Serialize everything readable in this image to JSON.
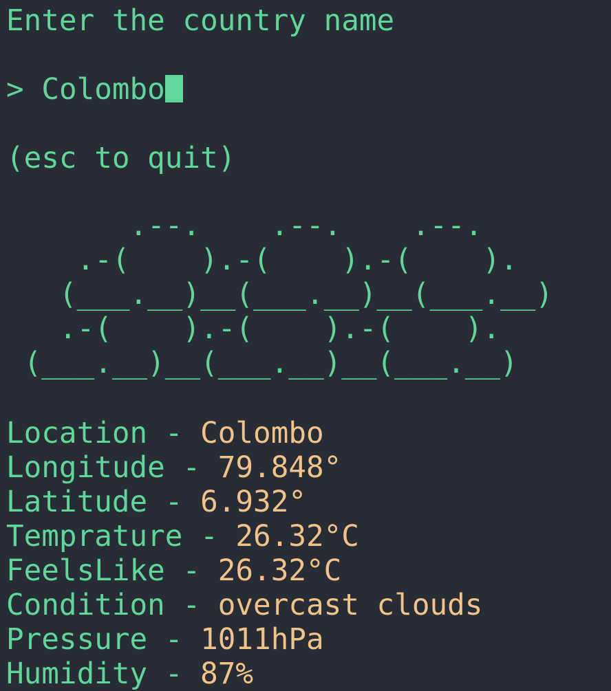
{
  "prompt": {
    "title": "Enter the country name",
    "marker": ">",
    "input_value": "Colombo",
    "hint": "(esc to quit)"
  },
  "weather_icon": {
    "name": "cloud-ascii-art",
    "lines": [
      "       .--.    .--.    .--.",
      "    .-(    ).-(    ).-(    ).",
      "   (___.__)__(___.__)__(___.__)",
      "   .-(    ).-(    ).-(    ).",
      " (___.__)__(___.__)__(___.__)"
    ]
  },
  "results": {
    "separator": "-",
    "location": {
      "label": "Location",
      "value": "Colombo"
    },
    "longitude": {
      "label": "Longitude",
      "value": "79.848°"
    },
    "latitude": {
      "label": "Latitude",
      "value": "6.932°"
    },
    "temperature": {
      "label": "Temprature",
      "value": "26.32°C"
    },
    "feels_like": {
      "label": "FeelsLike",
      "value": "26.32°C"
    },
    "condition": {
      "label": "Condition",
      "value": "overcast clouds"
    },
    "pressure": {
      "label": "Pressure",
      "value": "1011hPa"
    },
    "humidity": {
      "label": "Humidity",
      "value": "87%"
    }
  },
  "colors": {
    "background": "#282c34",
    "primary_text": "#5fd79b",
    "value_text": "#f0c38a"
  }
}
